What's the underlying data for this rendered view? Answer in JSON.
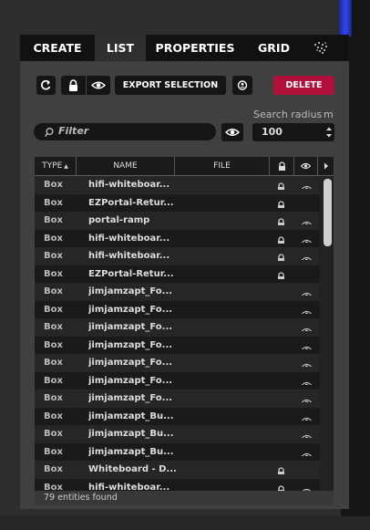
{
  "tabs": [
    {
      "id": "create",
      "label": "CREATE"
    },
    {
      "id": "list",
      "label": "LIST",
      "active": true
    },
    {
      "id": "properties",
      "label": "PROPERTIES"
    },
    {
      "id": "grid",
      "label": "GRID"
    }
  ],
  "toolbar": {
    "refresh_icon": "refresh-icon",
    "lock_icon": "lock-icon",
    "eye_icon": "eye-icon",
    "export_label": "EXPORT SELECTION",
    "locate_icon": "locate-icon",
    "delete_label": "DELETE",
    "accent_delete": "#b0103a"
  },
  "search": {
    "filter_placeholder": "Filter",
    "radius_label": "Search radius",
    "radius_unit": "m",
    "radius_value": "100"
  },
  "table": {
    "headers": {
      "type": "TYPE",
      "name": "NAME",
      "file": "FILE"
    },
    "rows": [
      {
        "type": "Box",
        "name": "hifi-whiteboar...",
        "locked": true,
        "visible": true
      },
      {
        "type": "Box",
        "name": "EZPortal-Retur...",
        "locked": true,
        "visible": false
      },
      {
        "type": "Box",
        "name": "portal-ramp",
        "locked": true,
        "visible": true
      },
      {
        "type": "Box",
        "name": "hifi-whiteboar...",
        "locked": true,
        "visible": true
      },
      {
        "type": "Box",
        "name": "hifi-whiteboar...",
        "locked": true,
        "visible": true
      },
      {
        "type": "Box",
        "name": "EZPortal-Retur...",
        "locked": true,
        "visible": false
      },
      {
        "type": "Box",
        "name": "jimjamzapt_Fo...",
        "locked": false,
        "visible": true
      },
      {
        "type": "Box",
        "name": "jimjamzapt_Fo...",
        "locked": false,
        "visible": true
      },
      {
        "type": "Box",
        "name": "jimjamzapt_Fo...",
        "locked": false,
        "visible": true
      },
      {
        "type": "Box",
        "name": "jimjamzapt_Fo...",
        "locked": false,
        "visible": true
      },
      {
        "type": "Box",
        "name": "jimjamzapt_Fo...",
        "locked": false,
        "visible": true
      },
      {
        "type": "Box",
        "name": "jimjamzapt_Fo...",
        "locked": false,
        "visible": true
      },
      {
        "type": "Box",
        "name": "jimjamzapt_Fo...",
        "locked": false,
        "visible": true
      },
      {
        "type": "Box",
        "name": "jimjamzapt_Bu...",
        "locked": false,
        "visible": true
      },
      {
        "type": "Box",
        "name": "jimjamzapt_Bu...",
        "locked": false,
        "visible": true
      },
      {
        "type": "Box",
        "name": "jimjamzapt_Bu...",
        "locked": false,
        "visible": true
      },
      {
        "type": "Box",
        "name": "Whiteboard - D...",
        "locked": true,
        "visible": false
      },
      {
        "type": "Box",
        "name": "hifi-whiteboar...",
        "locked": true,
        "visible": true
      }
    ]
  },
  "footer": {
    "count_text": "79 entities found"
  }
}
